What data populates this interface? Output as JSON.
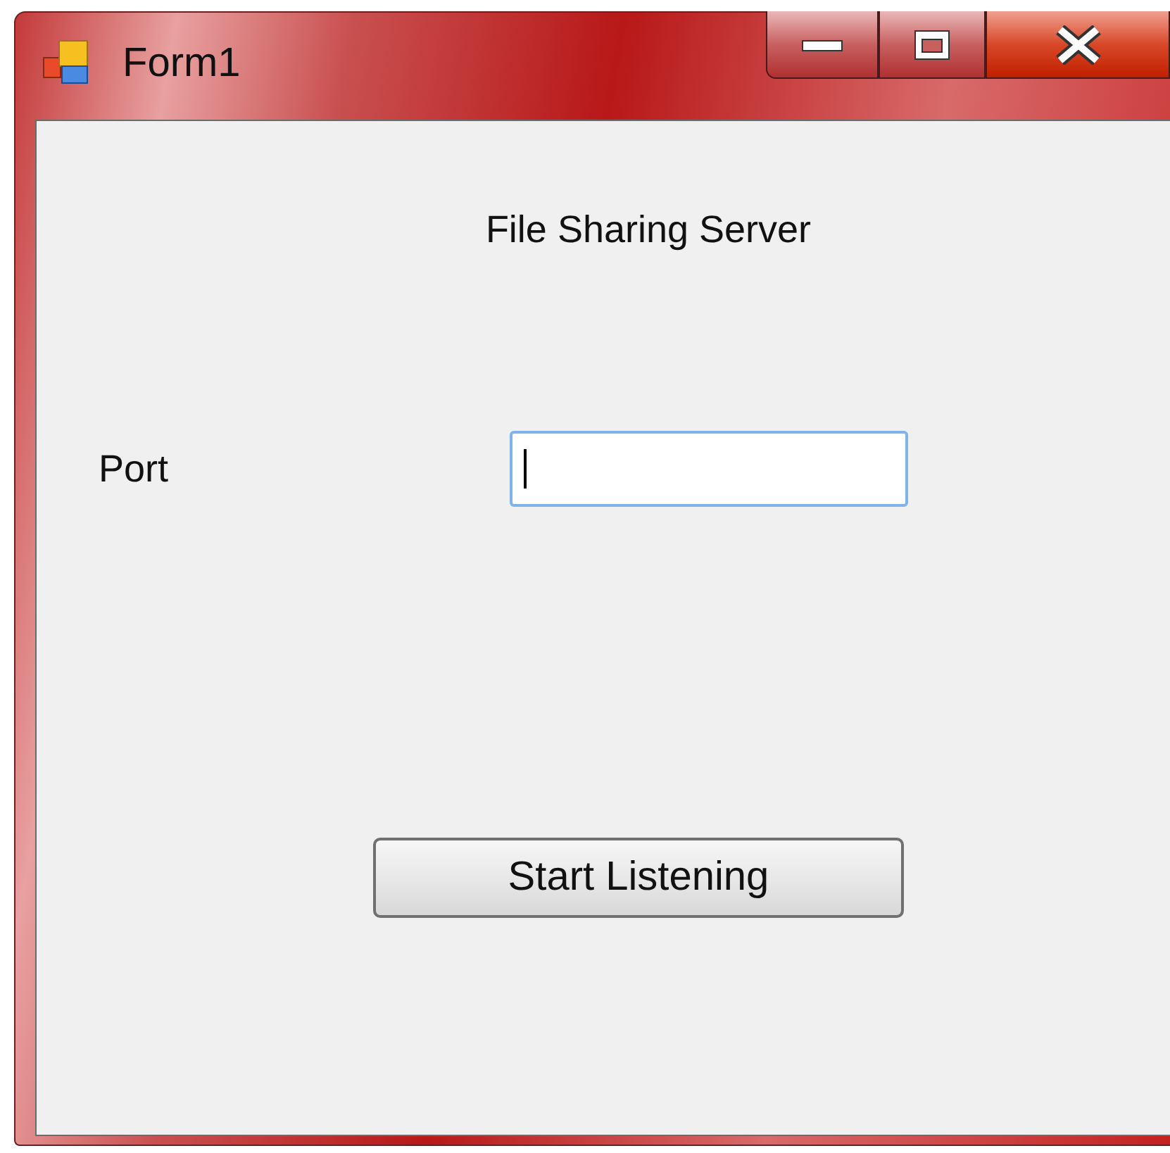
{
  "window": {
    "title": "Form1"
  },
  "heading": "File Sharing Server",
  "port_field": {
    "label": "Port",
    "focused": true
  },
  "buttons": [
    {
      "label": "Start Listening"
    }
  ]
}
